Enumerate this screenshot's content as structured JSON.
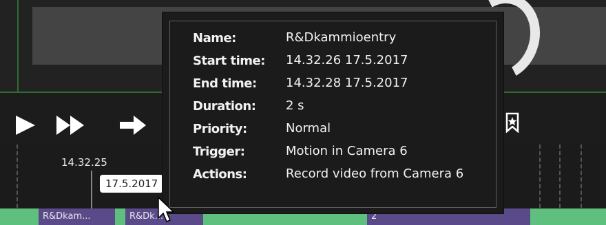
{
  "player": {
    "controls": [
      {
        "icon": "play-icon"
      },
      {
        "icon": "fast-forward-icon"
      },
      {
        "icon": "next-arrow-icon"
      }
    ],
    "bookmark_icon": "bookmark-star-icon"
  },
  "timeline": {
    "time_label": "14.32.25",
    "date_tag": "17.5.2017",
    "segments": [
      {
        "label": "R&Dkam...",
        "color": "#5b4a8a"
      },
      {
        "label": "R&Dk...",
        "color": "#5b4a8a"
      },
      {
        "label": "2",
        "color": "#5b4a8a"
      }
    ],
    "colors": {
      "track_green": "#5fbf7f",
      "track_purple": "#5b4a8a"
    }
  },
  "tooltip": {
    "rows": [
      {
        "key": "Name:",
        "value": "R&Dkammioentry"
      },
      {
        "key": "Start time:",
        "value": "14.32.26  17.5.2017"
      },
      {
        "key": "End time:",
        "value": "14.32.28  17.5.2017"
      },
      {
        "key": "Duration:",
        "value": "2 s"
      },
      {
        "key": "Priority:",
        "value": "Normal"
      },
      {
        "key": "Trigger:",
        "value": "Motion in Camera 6"
      },
      {
        "key": "Actions:",
        "value": "Record video from Camera 6"
      }
    ]
  }
}
